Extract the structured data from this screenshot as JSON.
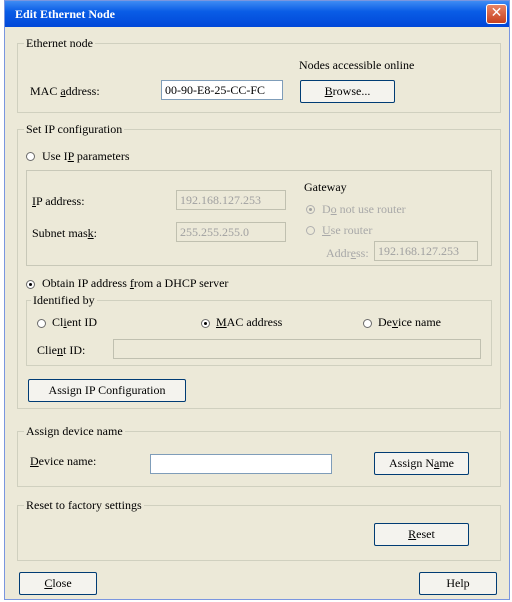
{
  "window": {
    "title": "Edit Ethernet Node"
  },
  "ethernet_node": {
    "group_label": "Ethernet node",
    "nodes_online_label": "Nodes accessible online",
    "mac_label": "MAC address:",
    "mac_value": "00-90-E8-25-CC-FC",
    "browse_label": "Browse..."
  },
  "ip_config": {
    "group_label": "Set IP configuration",
    "use_ip_label": "Use IP parameters",
    "ip_address_label": "IP address:",
    "ip_address_value": "192.168.127.253",
    "subnet_label": "Subnet mask:",
    "subnet_value": "255.255.255.0",
    "gateway_label": "Gateway",
    "no_router_label": "Do not use router",
    "use_router_label": "Use router",
    "router_address_label": "Address:",
    "router_address_value": "192.168.127.253",
    "dhcp_label": "Obtain IP address from a DHCP server",
    "identified_by_label": "Identified by",
    "client_id_radio": "Client ID",
    "mac_radio": "MAC address",
    "device_name_radio": "Device name",
    "client_id_field_label": "Client ID:",
    "client_id_value": "",
    "assign_button": "Assign IP Configuration"
  },
  "device_name": {
    "group_label": "Assign device name",
    "field_label": "Device name:",
    "value": "",
    "assign_button": "Assign Name"
  },
  "reset": {
    "group_label": "Reset to factory settings",
    "button": "Reset"
  },
  "footer": {
    "close_button": "Close",
    "help_button": "Help"
  }
}
